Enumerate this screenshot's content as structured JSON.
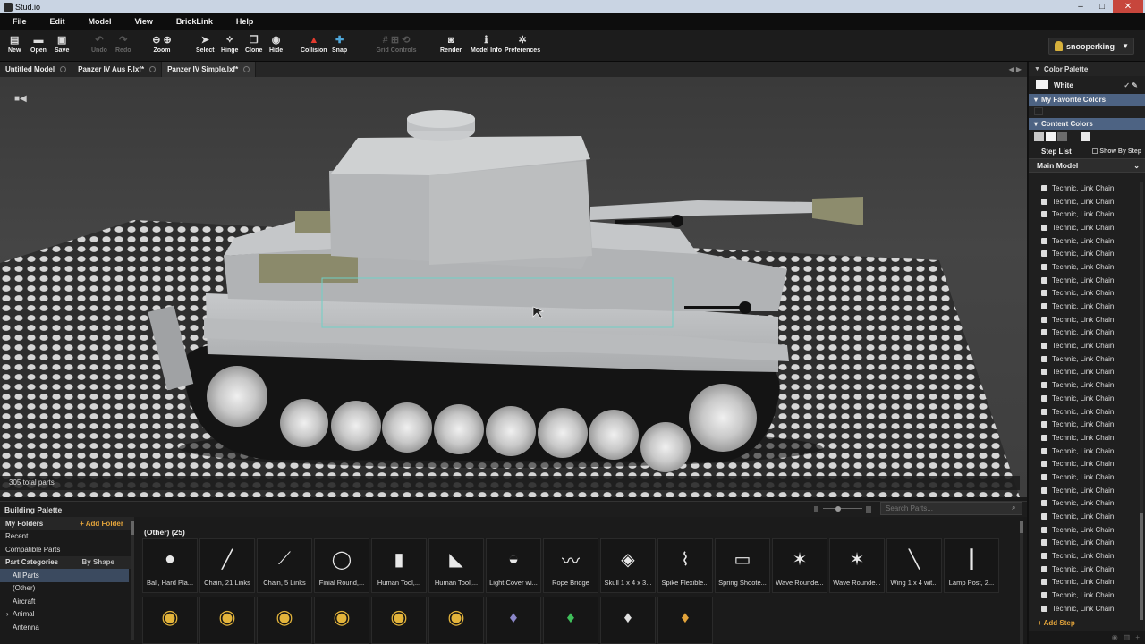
{
  "window": {
    "title": "Stud.io"
  },
  "menu": [
    "File",
    "Edit",
    "Model",
    "View",
    "BrickLink",
    "Help"
  ],
  "toolbar": {
    "new": "New",
    "open": "Open",
    "save": "Save",
    "undo": "Undo",
    "redo": "Redo",
    "zoom": "Zoom",
    "select": "Select",
    "hinge": "Hinge",
    "clone": "Clone",
    "hide": "Hide",
    "collision": "Collision",
    "snap": "Snap",
    "grid_controls": "Grid Controls",
    "render": "Render",
    "model_info": "Model Info",
    "preferences": "Preferences"
  },
  "user": {
    "name": "snooperking"
  },
  "tabs": [
    "Untitled Model",
    "Panzer IV Aus F.lxf*",
    "Panzer IV Simple.lxf*"
  ],
  "viewport": {
    "total_parts": "305 total parts"
  },
  "right_panel": {
    "color_palette": "Color Palette",
    "current_color": "White",
    "my_favorite_colors": "My Favorite Colors",
    "content_colors": "Content Colors",
    "step_list": "Step List",
    "show_by_step": "Show By Step",
    "main_model": "Main Model",
    "add_step": "+ Add Step",
    "parts": [
      "Technic, Link Chain",
      "Technic, Link Chain",
      "Technic, Link Chain",
      "Technic, Link Chain",
      "Technic, Link Chain",
      "Technic, Link Chain",
      "Technic, Link Chain",
      "Technic, Link Chain",
      "Technic, Link Chain",
      "Technic, Link Chain",
      "Technic, Link Chain",
      "Technic, Link Chain",
      "Technic, Link Chain",
      "Technic, Link Chain",
      "Technic, Link Chain",
      "Technic, Link Chain",
      "Technic, Link Chain",
      "Technic, Link Chain",
      "Technic, Link Chain",
      "Technic, Link Chain",
      "Technic, Link Chain",
      "Technic, Link Chain",
      "Technic, Link Chain",
      "Technic, Link Chain",
      "Technic, Link Chain",
      "Technic, Link Chain",
      "Technic, Link Chain",
      "Technic, Link Chain",
      "Technic, Link Chain",
      "Technic, Link Chain",
      "Technic, Link Chain",
      "Technic, Link Chain",
      "Technic, Link Chain"
    ],
    "content_swatches": [
      "#c8c8c8",
      "#f4f4f4",
      "#6b6b6b",
      "#1f1f1f",
      "#e8e8e8"
    ]
  },
  "palette": {
    "title": "Building Palette",
    "search_placeholder": "Search Parts...",
    "my_folders": "My Folders",
    "add_folder": "+ Add Folder",
    "recent": "Recent",
    "compatible_parts": "Compatible Parts",
    "part_categories": "Part Categories",
    "by_shape": "By Shape",
    "categories": [
      "All Parts",
      "(Other)",
      "Aircraft",
      "Animal",
      "Antenna"
    ],
    "group_title": "(Other) (25)",
    "parts_row1": [
      "Ball, Hard Pla...",
      "Chain, 21 Links",
      "Chain, 5 Links",
      "Finial Round,...",
      "Human Tool,...",
      "Human Tool,...",
      "Light Cover wi...",
      "Rope Bridge",
      "Skull 1 x 4 x 3...",
      "Spike Flexible...",
      "Spring Shoote...",
      "Wave Rounde...",
      "Wave Rounde...",
      "Wing 1 x 4 wit...",
      "Lamp Post, 2..."
    ]
  },
  "colors": {
    "accent_orange": "#e3a43b",
    "selection_blue": "#4d6383",
    "viewport_bg": "#404040"
  }
}
